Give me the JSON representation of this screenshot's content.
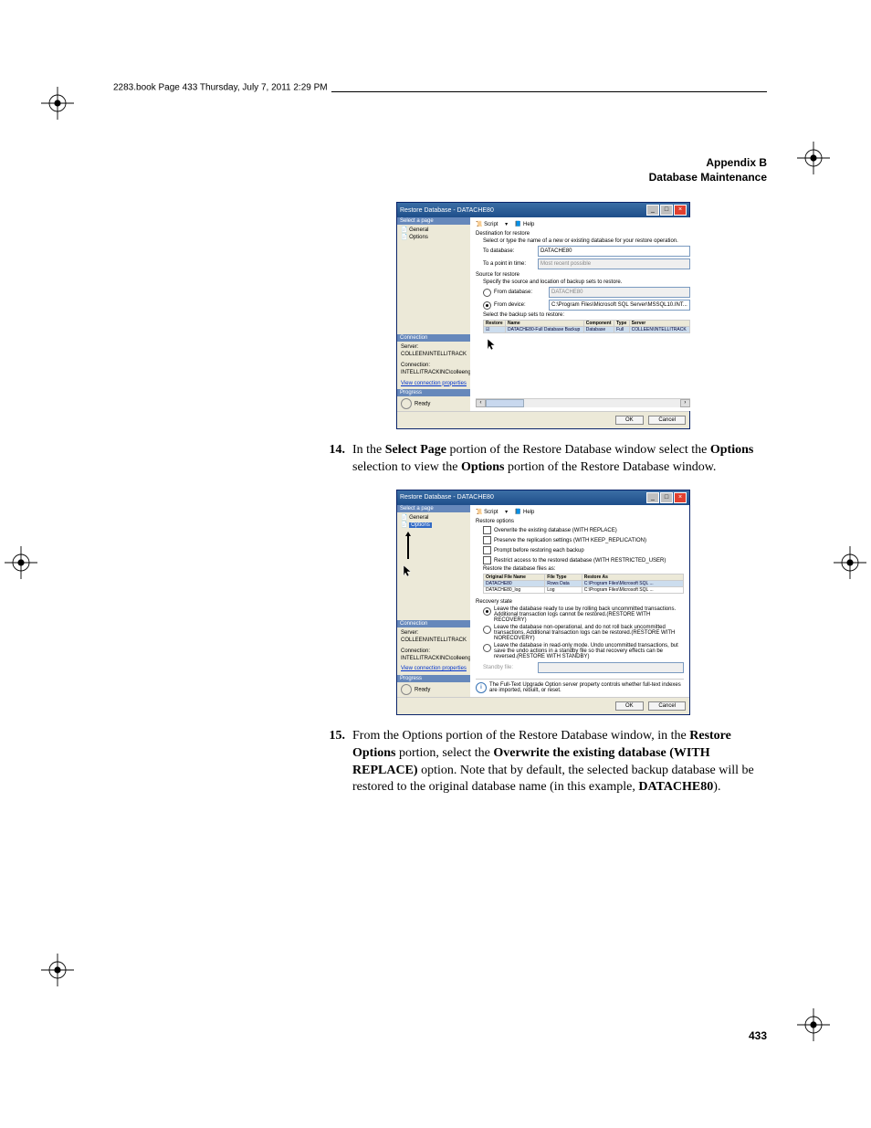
{
  "book_header": "2283.book  Page 433  Thursday, July 7, 2011  2:29 PM",
  "running_head": {
    "line1": "Appendix  B",
    "line2": "Database Maintenance"
  },
  "page_number": "433",
  "step14": {
    "num": "14.",
    "t1": "In the ",
    "b1": "Select Page",
    "t2": " portion of the Restore Database window select the ",
    "b2": "Options",
    "t3": " selection to view the ",
    "b3": "Options",
    "t4": " portion of the Restore Database window."
  },
  "step15": {
    "num": "15.",
    "t1": "From the Options portion of the Restore Database window, in the ",
    "b1": "Restore Options",
    "t2": " portion, select the ",
    "b2": "Overwrite the existing database (WITH REPLACE)",
    "t3": " option. Note that by default, the selected backup database will be restored to the original database name (in this example, ",
    "b3": "DATACHE80",
    "t4": ")."
  },
  "dlg": {
    "title": "Restore Database - DATACHE80",
    "select_page": "Select a page",
    "general": "General",
    "options": "Options",
    "connection_hdr": "Connection",
    "server_lbl": "Server:",
    "server_val": "COLLEEN\\INTELLITRACK",
    "conn_lbl": "Connection:",
    "conn_val": "INTELLITRACKINC\\colleeng",
    "view_conn": "View connection properties",
    "progress_hdr": "Progress",
    "ready": "Ready",
    "script": "Script",
    "help": "Help",
    "ok": "OK",
    "cancel": "Cancel"
  },
  "dlg1": {
    "dest_hdr": "Destination for restore",
    "dest_note": "Select or type the name of a new or existing database for your restore operation.",
    "to_db": "To database:",
    "to_db_val": "DATACHE80",
    "to_point": "To a point in time:",
    "to_point_val": "Most recent possible",
    "src_hdr": "Source for restore",
    "src_note": "Specify the source and location of backup sets to restore.",
    "from_db": "From database:",
    "from_db_val": "DATACHE80",
    "from_dev": "From device:",
    "from_dev_val": "C:\\Program Files\\Microsoft SQL Server\\MSSQL10.INT...",
    "sets_hdr": "Select the backup sets to restore:",
    "h_restore": "Restore",
    "h_name": "Name",
    "h_comp": "Component",
    "h_type": "Type",
    "h_server": "Server",
    "row_name": "DATACHE80-Full Database Backup",
    "row_comp": "Database",
    "row_type": "Full",
    "row_server": "COLLEEN\\INTELLITRACK"
  },
  "dlg2": {
    "ropt_hdr": "Restore options",
    "opt1": "Overwrite the existing database (WITH REPLACE)",
    "opt2": "Preserve the replication settings (WITH KEEP_REPLICATION)",
    "opt3": "Prompt before restoring each backup",
    "opt4": "Restrict access to the restored database (WITH RESTRICTED_USER)",
    "files_hdr": "Restore the database files as:",
    "h_ofn": "Original File Name",
    "h_ft": "File Type",
    "h_ra": "Restore As",
    "r1_ofn": "DATACHE80",
    "r1_ft": "Rows Data",
    "r1_ra": "C:\\Program Files\\Microsoft SQL ...",
    "r2_ofn": "DATACHE80_log",
    "r2_ft": "Log",
    "r2_ra": "C:\\Program Files\\Microsoft SQL ...",
    "rec_hdr": "Recovery state",
    "rec1": "Leave the database ready to use by rolling back uncommitted transactions. Additional transaction logs cannot be restored.(RESTORE WITH RECOVERY)",
    "rec2": "Leave the database non-operational, and do not roll back uncommitted transactions. Additional transaction logs can be restored.(RESTORE WITH NORECOVERY)",
    "rec3": "Leave the database in read-only mode. Undo uncommitted transactions, but save the undo actions in a standby file so that recovery effects can be reversed.(RESTORE WITH STANDBY)",
    "standby": "Standby file:",
    "note": "The Full-Text Upgrade Option server property controls whether full-text indexes are imported, rebuilt, or reset."
  }
}
